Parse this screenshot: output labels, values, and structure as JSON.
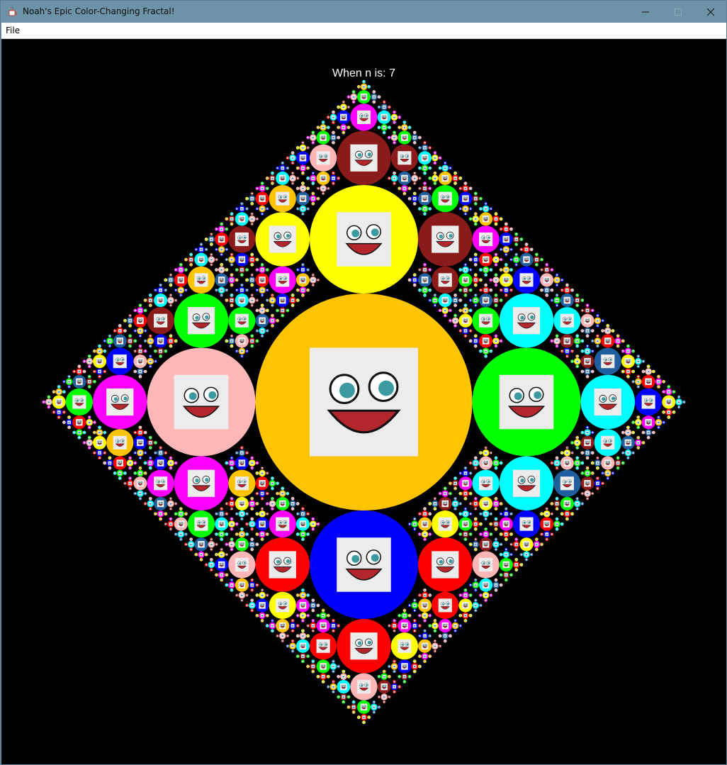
{
  "window": {
    "title": "Noah's Epic Color-Changing Fractal!",
    "icon": "java-cup-icon",
    "controls": [
      "minimize-icon",
      "maximize-icon",
      "close-icon"
    ]
  },
  "menu": {
    "items": [
      {
        "label": "File"
      }
    ]
  },
  "canvas": {
    "background": "#000000",
    "label": "When n is: 7",
    "depth": 7,
    "center_fill": "#ffc400",
    "palette": [
      "#ffff00",
      "#00ff00",
      "#0000ff",
      "#ffb6b6",
      "#ff00ff",
      "#00ffff",
      "#ff0000",
      "#8b1a1a",
      "#ffc400",
      "#1f5f9e"
    ],
    "face_icon": "cartoon-smiley-face-icon"
  }
}
